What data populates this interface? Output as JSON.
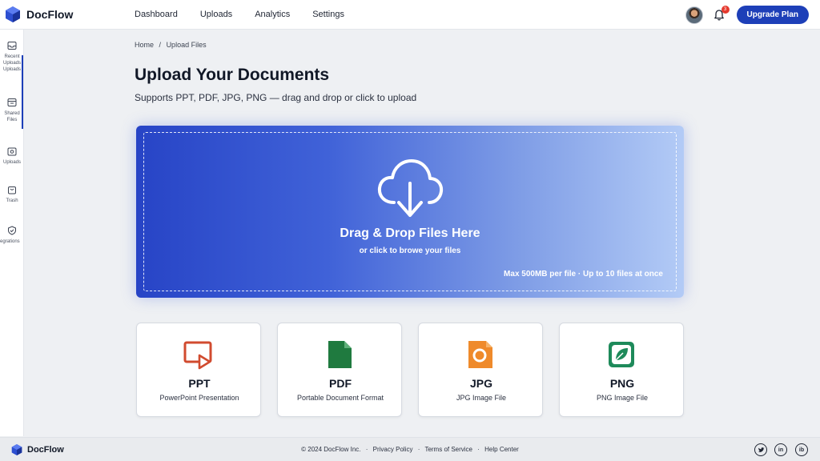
{
  "app": {
    "name": "DocFlow"
  },
  "nav": [
    "Dashboard",
    "Uploads",
    "Analytics",
    "Settings"
  ],
  "notifications": {
    "count": "3"
  },
  "upgrade_label": "Upgrade Plan",
  "sidebar": {
    "items": [
      {
        "label": "Recent Uploads Uploads",
        "icon": "inbox-icon"
      },
      {
        "label": "Shared Files",
        "icon": "shared-folder-icon"
      },
      {
        "label": "Uploads",
        "icon": "upload-box-icon"
      },
      {
        "label": "Trash",
        "icon": "trash-icon"
      },
      {
        "label": "egrations",
        "icon": "shield-check-icon"
      }
    ]
  },
  "breadcrumb": {
    "home": "Home",
    "separator": "/",
    "current": "Upload Files"
  },
  "page": {
    "title": "Upload Your Documents",
    "subtitle": "Supports PPT, PDF, JPG, PNG — drag and drop or click to upload"
  },
  "dropzone": {
    "title": "Drag & Drop Files Here",
    "subtitle": "or click to browe your files",
    "note": "Max 500MB per file · Up to 10 files at once",
    "icon": "cloud-download-icon"
  },
  "file_types": [
    {
      "name": "PPT",
      "desc": "PowerPoint Presentation",
      "color": "#d14b2f",
      "icon": "ppt-icon"
    },
    {
      "name": "PDF",
      "desc": "Portable Document Format",
      "color": "#1f7a3f",
      "icon": "pdf-icon"
    },
    {
      "name": "JPG",
      "desc": "JPG Image File",
      "color": "#ef8a2b",
      "icon": "jpg-icon"
    },
    {
      "name": "PNG",
      "desc": "PNG Image File",
      "color": "#1e8a5a",
      "icon": "png-icon"
    }
  ],
  "footer": {
    "copyright": "© 2024 DocFlow Inc.",
    "separator": "·",
    "links": [
      "Privacy Policy",
      "Terms of Service",
      "Help Center"
    ],
    "social": [
      "twitter-icon",
      "linkedin-icon",
      "ib-icon"
    ],
    "social_text": {
      "linkedin": "in",
      "ib": "ib"
    }
  },
  "colors": {
    "accent": "#1d3fb8",
    "badge": "#e5392e"
  }
}
